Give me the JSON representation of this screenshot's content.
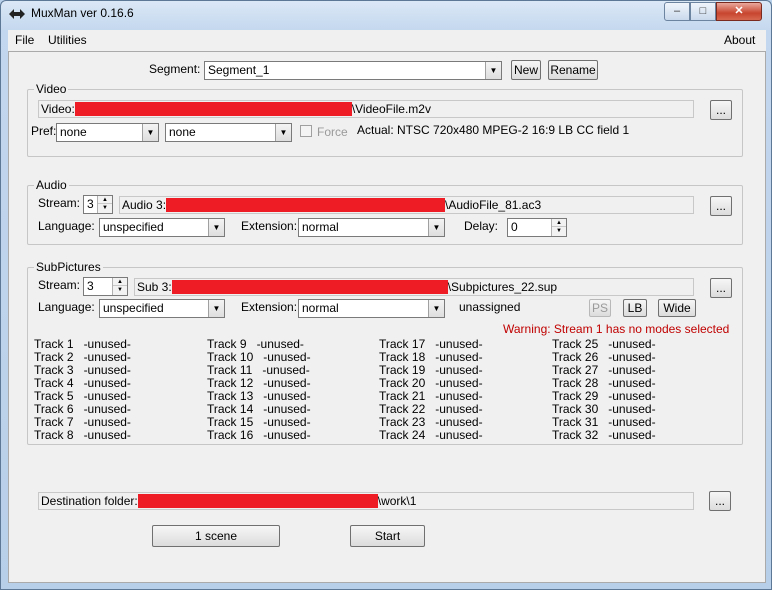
{
  "window": {
    "title": "MuxMan ver 0.16.6",
    "min_glyph": "–",
    "max_glyph": "□",
    "close_glyph": "✕",
    "app_icon": "muxman-app-icon"
  },
  "menu": {
    "file": "File",
    "utilities": "Utilities",
    "about": "About"
  },
  "segment": {
    "label": "Segment:",
    "value": "Segment_1",
    "new_label": "New",
    "rename_label": "Rename"
  },
  "video": {
    "group_title": "Video",
    "file_prefix": "Video:",
    "file_suffix": "\\VideoFile.m2v",
    "browse": "...",
    "pref_label": "Pref:",
    "pref1": "none",
    "pref2": "none",
    "force_label": "Force",
    "actual": "Actual: NTSC 720x480  MPEG-2  16:9 LB  CC field 1"
  },
  "audio": {
    "group_title": "Audio",
    "stream_label": "Stream:",
    "stream_value": "3",
    "file_prefix": "Audio 3:",
    "file_suffix": "\\AudioFile_81.ac3",
    "browse": "...",
    "language_label": "Language:",
    "language_value": "unspecified",
    "extension_label": "Extension:",
    "extension_value": "normal",
    "delay_label": "Delay:",
    "delay_value": "0"
  },
  "subpictures": {
    "group_title": "SubPictures",
    "stream_label": "Stream:",
    "stream_value": "3",
    "file_prefix": "Sub 3:",
    "file_suffix": "\\Subpictures_22.sup",
    "browse": "...",
    "language_label": "Language:",
    "language_value": "unspecified",
    "extension_label": "Extension:",
    "extension_value": "normal",
    "status": "unassigned",
    "ps_label": "PS",
    "lb_label": "LB",
    "wide_label": "Wide",
    "warning": "Warning: Stream 1 has no modes selected",
    "tracks": [
      [
        "Track 1   -unused-",
        "Track 2   -unused-",
        "Track 3   -unused-",
        "Track 4   -unused-",
        "Track 5   -unused-",
        "Track 6   -unused-",
        "Track 7   -unused-",
        "Track 8   -unused-"
      ],
      [
        "Track 9   -unused-",
        "Track 10   -unused-",
        "Track 11   -unused-",
        "Track 12   -unused-",
        "Track 13   -unused-",
        "Track 14   -unused-",
        "Track 15   -unused-",
        "Track 16   -unused-"
      ],
      [
        "Track 17   -unused-",
        "Track 18   -unused-",
        "Track 19   -unused-",
        "Track 20   -unused-",
        "Track 21   -unused-",
        "Track 22   -unused-",
        "Track 23   -unused-",
        "Track 24   -unused-"
      ],
      [
        "Track 25   -unused-",
        "Track 26   -unused-",
        "Track 27   -unused-",
        "Track 28   -unused-",
        "Track 29   -unused-",
        "Track 30   -unused-",
        "Track 31   -unused-",
        "Track 32   -unused-"
      ]
    ]
  },
  "destination": {
    "prefix": "Destination folder:",
    "suffix": "\\work\\1",
    "browse": "..."
  },
  "actions": {
    "scene_label": "1 scene",
    "start_label": "Start"
  },
  "colors": {
    "redaction": "#ee1c24",
    "warning": "#c00000"
  }
}
